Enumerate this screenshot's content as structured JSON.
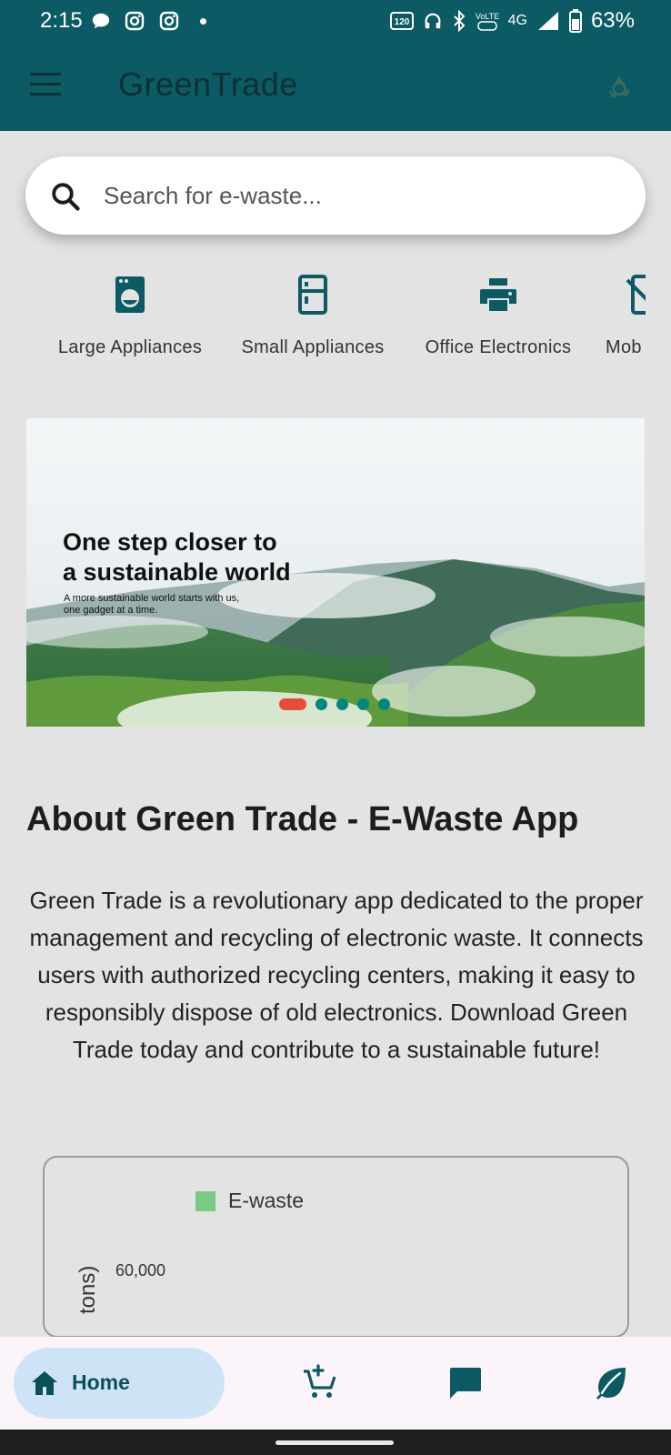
{
  "status_bar": {
    "time": "2:15",
    "battery": "63%",
    "network": "4G",
    "left_icons": [
      "chat-bubble-icon",
      "instagram-icon",
      "instagram-icon",
      "dot-icon"
    ],
    "right_icons": [
      "refresh-rate-icon",
      "headphones-icon",
      "bluetooth-icon",
      "volte-icon",
      "signal-icon",
      "battery-icon"
    ]
  },
  "app_bar": {
    "title": "GreenTrade",
    "menu_icon": "menu-icon",
    "action_icon": "recycle-icon"
  },
  "search": {
    "placeholder": "Search for e-waste..."
  },
  "categories": [
    {
      "label": "Large Appliances",
      "icon": "washing-machine-icon"
    },
    {
      "label": "Small Appliances",
      "icon": "fridge-icon"
    },
    {
      "label": "Office Electronics",
      "icon": "printer-icon"
    },
    {
      "label": "Mob",
      "icon": "mobile-off-icon"
    }
  ],
  "banner": {
    "heading_line1": "One step closer to",
    "heading_line2": "a sustainable world",
    "subtext_line1": "A more sustainable world starts with us,",
    "subtext_line2": "one gadget at a time.",
    "slide_count": 5,
    "active_slide": 0
  },
  "about": {
    "title": "About Green Trade - E-Waste App",
    "body": "Green Trade is a revolutionary app dedicated to the proper management and recycling of electronic waste. It connects users with authorized recycling centers, making it easy to responsibly dispose of old electronics. Download Green Trade today and contribute to a sustainable future!"
  },
  "chart": {
    "legend": "E-waste",
    "y_label_visible": "tons)",
    "y_tick": "60,000",
    "series_color": "#7cc986"
  },
  "bottom_nav": {
    "home_label": "Home",
    "items": [
      "home-icon",
      "add-to-cart-icon",
      "chat-icon",
      "leaf-icon"
    ]
  },
  "colors": {
    "primary": "#0b5a64",
    "accent_dot": "#00897b",
    "active_dot": "#e84b3c",
    "nav_active_bg": "#cfe3f6"
  }
}
